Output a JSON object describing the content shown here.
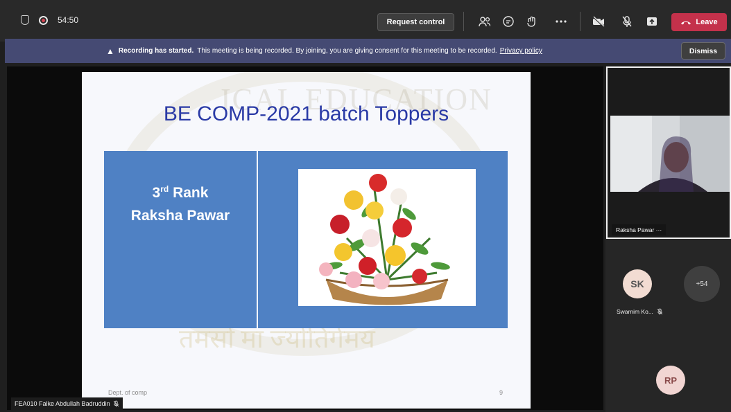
{
  "topbar": {
    "timer": "54:50",
    "request_control_label": "Request control",
    "leave_label": "Leave"
  },
  "banner": {
    "bold_text": "Recording has started.",
    "text": "This meeting is being recorded. By joining, you are giving consent for this meeting to be recorded.",
    "link_text": "Privacy policy",
    "dismiss_label": "Dismiss"
  },
  "slide": {
    "title": "BE COMP-2021 batch Toppers",
    "rank_number": "3",
    "rank_suffix": "rd",
    "rank_word": "Rank",
    "name": "Raksha Pawar",
    "footer": "Dept. of comp",
    "page_number": "9"
  },
  "presenter": {
    "name": "FEA010 Falke Abdullah Badruddin"
  },
  "participants": {
    "video_name": "Raksha Pawar",
    "video_more": "···",
    "sk_initials": "SK",
    "sk_name": "Swarnim Ko...",
    "more_count": "+54",
    "rp_initials": "RP"
  },
  "colors": {
    "leave": "#c4314b",
    "banner": "#454a73",
    "slide_box": "#4f81c4",
    "title": "#2a3aa6"
  }
}
